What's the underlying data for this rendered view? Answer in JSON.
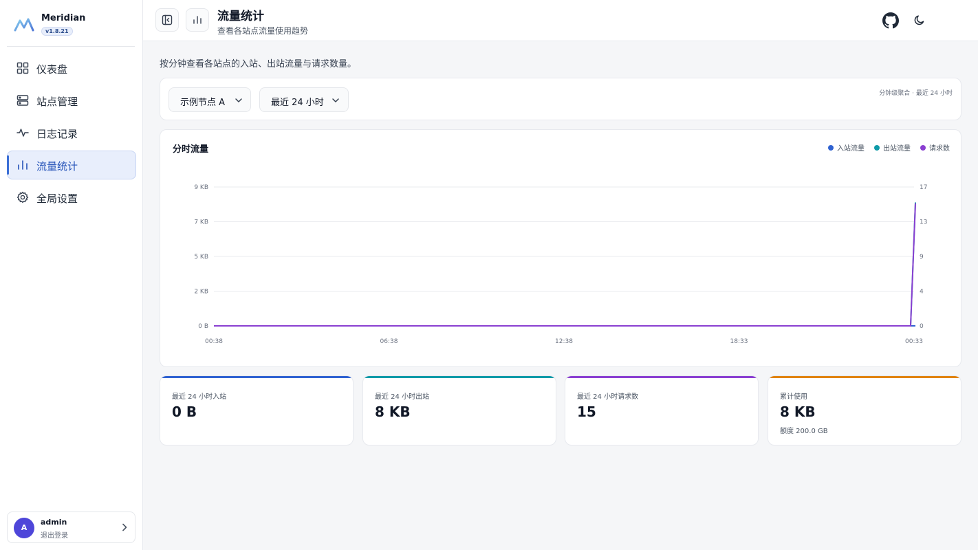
{
  "brand": {
    "name": "Meridian",
    "version": "v1.8.21"
  },
  "sidebar": {
    "items": [
      {
        "label": "仪表盘",
        "icon": "dashboard-grid-icon"
      },
      {
        "label": "站点管理",
        "icon": "server-icon"
      },
      {
        "label": "日志记录",
        "icon": "activity-icon"
      },
      {
        "label": "流量统计",
        "icon": "bar-chart-icon",
        "active": true
      },
      {
        "label": "全局设置",
        "icon": "gear-icon"
      }
    ]
  },
  "user": {
    "name": "admin",
    "initial": "A",
    "action": "退出登录"
  },
  "header": {
    "title": "流量统计",
    "subtitle": "查看各站点流量使用趋势"
  },
  "main": {
    "intro": "按分钟查看各站点的入站、出站流量与请求数量。",
    "filters": {
      "node": "示例节点 A",
      "range": "最近 24 小时",
      "note": "分钟级聚合 · 最近 24 小时"
    }
  },
  "chart_data": {
    "type": "line",
    "title": "分时流量",
    "legend_position": "top-right",
    "grid": true,
    "x": [
      "00:38",
      "06:38",
      "12:38",
      "18:33",
      "00:33"
    ],
    "y_left_ticks": [
      "0 B",
      "2 KB",
      "5 KB",
      "7 KB",
      "9 KB"
    ],
    "y_right_ticks": [
      "0",
      "4",
      "9",
      "13",
      "17"
    ],
    "series": [
      {
        "name": "入站流量",
        "color": "#2f62d1",
        "axis": "left",
        "values": [
          0,
          0,
          0,
          0,
          0
        ]
      },
      {
        "name": "出站流量",
        "color": "#0e9aa8",
        "axis": "left",
        "values": [
          0,
          0,
          0,
          0,
          8192
        ]
      },
      {
        "name": "请求数",
        "color": "#8a3fd1",
        "axis": "right",
        "values": [
          0,
          0,
          0,
          0,
          15
        ]
      }
    ]
  },
  "stats": [
    {
      "label": "最近 24 小时入站",
      "value": "0 B",
      "color": "#2f62d1"
    },
    {
      "label": "最近 24 小时出站",
      "value": "8 KB",
      "color": "#0e9aa8"
    },
    {
      "label": "最近 24 小时请求数",
      "value": "15",
      "color": "#8a3fd1"
    },
    {
      "label": "累计使用",
      "value": "8 KB",
      "sub": "额度 200.0 GB",
      "color": "#e0830f"
    }
  ]
}
